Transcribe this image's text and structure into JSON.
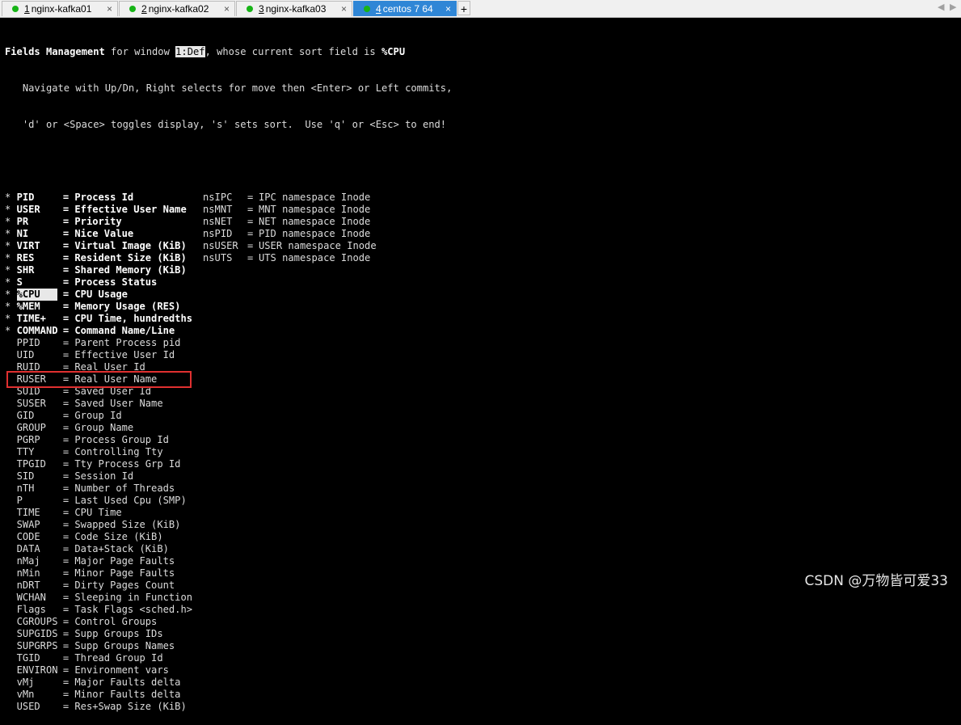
{
  "tabs": [
    {
      "num": "1",
      "label": "nginx-kafka01",
      "active": false
    },
    {
      "num": "2",
      "label": "nginx-kafka02",
      "active": false
    },
    {
      "num": "3",
      "label": "nginx-kafka03",
      "active": false
    },
    {
      "num": "4",
      "label": "centos 7 64",
      "active": true
    }
  ],
  "tab_close_glyph": "×",
  "add_tab_glyph": "+",
  "nav": {
    "left": "◀",
    "right": "▶"
  },
  "header": {
    "title_bold": "Fields Management",
    "title_mid": " for window ",
    "window": "1:Def",
    "title_tail": ", whose current sort field is ",
    "sort_field": "%CPU",
    "help1": "   Navigate with Up/Dn, Right selects for move then <Enter> or Left commits,",
    "help2": "   'd' or <Space> toggles display, 's' sets sort.  Use 'q' or <Esc> to end!"
  },
  "fields": [
    {
      "mark": "*",
      "name": "PID",
      "desc": "Process Id",
      "on": true
    },
    {
      "mark": "*",
      "name": "USER",
      "desc": "Effective User Name",
      "on": true
    },
    {
      "mark": "*",
      "name": "PR",
      "desc": "Priority",
      "on": true
    },
    {
      "mark": "*",
      "name": "NI",
      "desc": "Nice Value",
      "on": true
    },
    {
      "mark": "*",
      "name": "VIRT",
      "desc": "Virtual Image (KiB)",
      "on": true
    },
    {
      "mark": "*",
      "name": "RES",
      "desc": "Resident Size (KiB)",
      "on": true
    },
    {
      "mark": "*",
      "name": "SHR",
      "desc": "Shared Memory (KiB)",
      "on": true
    },
    {
      "mark": "*",
      "name": "S",
      "desc": "Process Status",
      "on": true
    },
    {
      "mark": "*",
      "name": "%CPU",
      "desc": "CPU Usage",
      "on": true,
      "selected": true
    },
    {
      "mark": "*",
      "name": "%MEM",
      "desc": "Memory Usage (RES)",
      "on": true
    },
    {
      "mark": "*",
      "name": "TIME+",
      "desc": "CPU Time, hundredths",
      "on": true
    },
    {
      "mark": "*",
      "name": "COMMAND",
      "desc": "Command Name/Line",
      "on": true
    },
    {
      "mark": " ",
      "name": "PPID",
      "desc": "Parent Process pid",
      "on": false
    },
    {
      "mark": " ",
      "name": "UID",
      "desc": "Effective User Id",
      "on": false
    },
    {
      "mark": " ",
      "name": "RUID",
      "desc": "Real User Id",
      "on": false
    },
    {
      "mark": " ",
      "name": "RUSER",
      "desc": "Real User Name",
      "on": false
    },
    {
      "mark": " ",
      "name": "SUID",
      "desc": "Saved User Id",
      "on": false
    },
    {
      "mark": " ",
      "name": "SUSER",
      "desc": "Saved User Name",
      "on": false
    },
    {
      "mark": " ",
      "name": "GID",
      "desc": "Group Id",
      "on": false
    },
    {
      "mark": " ",
      "name": "GROUP",
      "desc": "Group Name",
      "on": false
    },
    {
      "mark": " ",
      "name": "PGRP",
      "desc": "Process Group Id",
      "on": false
    },
    {
      "mark": " ",
      "name": "TTY",
      "desc": "Controlling Tty",
      "on": false
    },
    {
      "mark": " ",
      "name": "TPGID",
      "desc": "Tty Process Grp Id",
      "on": false
    },
    {
      "mark": " ",
      "name": "SID",
      "desc": "Session Id",
      "on": false
    },
    {
      "mark": " ",
      "name": "nTH",
      "desc": "Number of Threads",
      "on": false
    },
    {
      "mark": " ",
      "name": "P",
      "desc": "Last Used Cpu (SMP)",
      "on": false,
      "boxed": true
    },
    {
      "mark": " ",
      "name": "TIME",
      "desc": "CPU Time",
      "on": false
    },
    {
      "mark": " ",
      "name": "SWAP",
      "desc": "Swapped Size (KiB)",
      "on": false
    },
    {
      "mark": " ",
      "name": "CODE",
      "desc": "Code Size (KiB)",
      "on": false
    },
    {
      "mark": " ",
      "name": "DATA",
      "desc": "Data+Stack (KiB)",
      "on": false
    },
    {
      "mark": " ",
      "name": "nMaj",
      "desc": "Major Page Faults",
      "on": false
    },
    {
      "mark": " ",
      "name": "nMin",
      "desc": "Minor Page Faults",
      "on": false
    },
    {
      "mark": " ",
      "name": "nDRT",
      "desc": "Dirty Pages Count",
      "on": false
    },
    {
      "mark": " ",
      "name": "WCHAN",
      "desc": "Sleeping in Function",
      "on": false
    },
    {
      "mark": " ",
      "name": "Flags",
      "desc": "Task Flags <sched.h>",
      "on": false
    },
    {
      "mark": " ",
      "name": "CGROUPS",
      "desc": "Control Groups",
      "on": false
    },
    {
      "mark": " ",
      "name": "SUPGIDS",
      "desc": "Supp Groups IDs",
      "on": false
    },
    {
      "mark": " ",
      "name": "SUPGRPS",
      "desc": "Supp Groups Names",
      "on": false
    },
    {
      "mark": " ",
      "name": "TGID",
      "desc": "Thread Group Id",
      "on": false
    },
    {
      "mark": " ",
      "name": "ENVIRON",
      "desc": "Environment vars",
      "on": false
    },
    {
      "mark": " ",
      "name": "vMj",
      "desc": "Major Faults delta",
      "on": false
    },
    {
      "mark": " ",
      "name": "vMn",
      "desc": "Minor Faults delta",
      "on": false
    },
    {
      "mark": " ",
      "name": "USED",
      "desc": "Res+Swap Size (KiB)",
      "on": false
    }
  ],
  "ns_fields": [
    {
      "name": "nsIPC",
      "desc": "IPC namespace Inode"
    },
    {
      "name": "nsMNT",
      "desc": "MNT namespace Inode"
    },
    {
      "name": "nsNET",
      "desc": "NET namespace Inode"
    },
    {
      "name": "nsPID",
      "desc": "PID namespace Inode"
    },
    {
      "name": "nsUSER",
      "desc": "USER namespace Inode"
    },
    {
      "name": "nsUTS",
      "desc": "UTS namespace Inode"
    }
  ],
  "watermark": "CSDN @万物皆可爱33",
  "colors": {
    "tab_active": "#2f86d6",
    "status_dot": "#17b417",
    "highlight_box": "#e03030"
  }
}
